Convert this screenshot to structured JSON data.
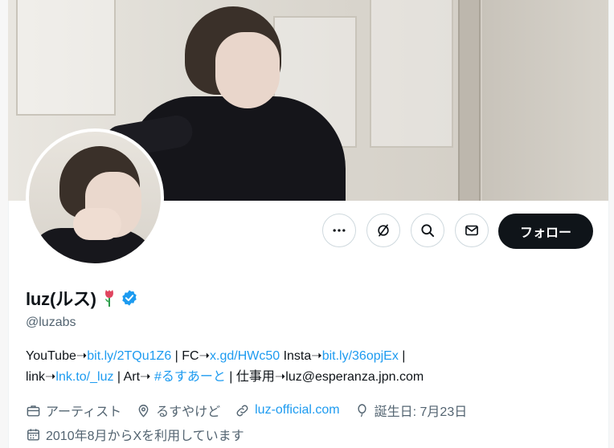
{
  "profile": {
    "display_name": "luz(ルス)",
    "handle": "@luzabs",
    "emoji_icon": "tulip-icon",
    "verified_icon": "verified-badge-icon"
  },
  "actions": {
    "more_icon": "more-icon",
    "subscribe_icon": "subscribe-icon",
    "search_icon": "search-icon",
    "message_icon": "message-icon",
    "follow_label": "フォロー"
  },
  "bio": {
    "l1_a": "YouTube➝",
    "l1_link1": "bit.ly/2TQu1Z6",
    "l1_b": " | FC➝",
    "l1_link2": "x.gd/HWc50",
    "l1_c": " Insta➝",
    "l1_link3": "bit.ly/36opjEx",
    "l1_d": " |",
    "l2_a": "link➝",
    "l2_link1": "lnk.to/_luz",
    "l2_b": " | Art➝ ",
    "l2_link2": "#るすあーと",
    "l2_c": " | 仕事用➝luz@esperanza.jpn.com"
  },
  "meta": {
    "category": "アーティスト",
    "location": "るすやけど",
    "website": "luz-official.com",
    "birthday": "誕生日: 7月23日",
    "joined": "2010年8月からXを利用しています"
  },
  "colors": {
    "accent": "#1d9bf0",
    "text": "#0f1419",
    "secondary": "#536471",
    "button_dark": "#0f1419"
  }
}
